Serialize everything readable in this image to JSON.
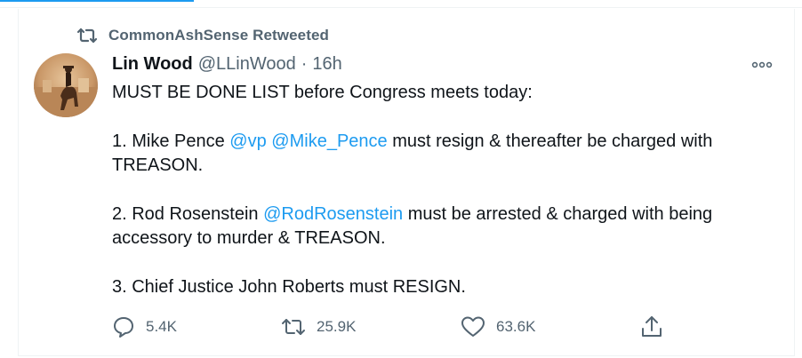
{
  "retweet_context": {
    "text": "CommonAshSense Retweeted",
    "icon": "retweet-icon"
  },
  "author": {
    "name": "Lin Wood",
    "handle": "@LLinWood",
    "separator": "·",
    "time": "16h"
  },
  "tweet": {
    "intro": "MUST BE DONE LIST before Congress meets today:",
    "item1": {
      "before": "1. Mike Pence ",
      "mention1": "@vp",
      "mention2": "@Mike_Pence",
      "after": " must resign & thereafter be charged with TREASON."
    },
    "item2": {
      "before": "2. Rod Rosenstein ",
      "mention": "@RodRosenstein",
      "after": " must be arrested & charged with being accessory to murder & TREASON."
    },
    "item3": "3. Chief Justice John Roberts must RESIGN."
  },
  "actions": {
    "replies": "5.4K",
    "retweets": "25.9K",
    "likes": "63.6K"
  },
  "colors": {
    "accent": "#1d9bf0",
    "secondary_text": "#536471",
    "primary_text": "#0f1419"
  }
}
